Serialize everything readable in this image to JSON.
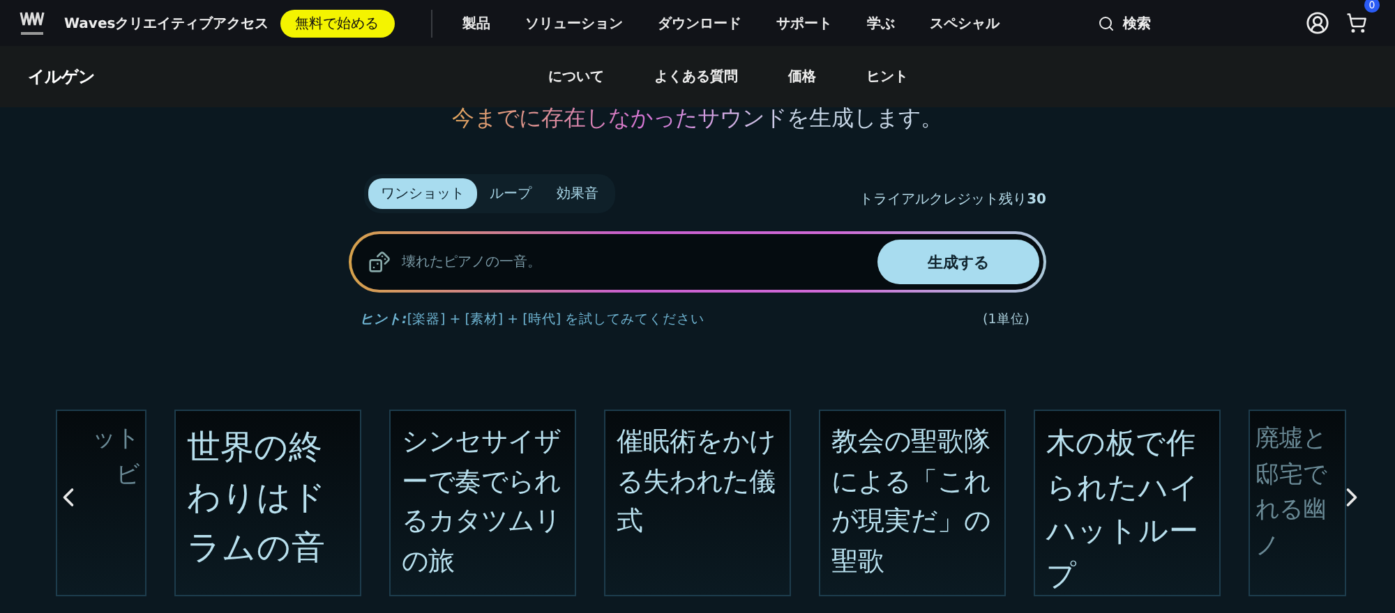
{
  "top_bar": {
    "brand": "Wavesクリエイティブアクセス",
    "cta": "無料で始める",
    "menu": [
      {
        "label": "製品"
      },
      {
        "label": "ソリューション"
      },
      {
        "label": "ダウンロード"
      },
      {
        "label": "サポート"
      },
      {
        "label": "学ぶ"
      },
      {
        "label": "スペシャル"
      }
    ],
    "search": "検索",
    "cart_count": "0"
  },
  "sub_bar": {
    "title": "イルゲン",
    "links": [
      {
        "label": "について"
      },
      {
        "label": "よくある質問"
      },
      {
        "label": "価格"
      },
      {
        "label": "ヒント"
      }
    ]
  },
  "headline": "今までに存在しなかったサウンドを生成します。",
  "mode_tabs": [
    {
      "label": "ワンショット",
      "selected": true
    },
    {
      "label": "ループ",
      "selected": false
    },
    {
      "label": "効果音",
      "selected": false
    }
  ],
  "credits": {
    "label": "トライアルクレジット残り",
    "count": "30"
  },
  "prompt": {
    "placeholder": "壊れたピアノの一音。",
    "button": "生成する"
  },
  "hint": "**ヒント:**[楽器] + [素材] + [時代] を試してみてください",
  "unit": "(1単位)",
  "cards": [
    {
      "kind": "partial_left",
      "text": "ットビ"
    },
    {
      "kind": "full",
      "text": "世界の終わりはドラムの音"
    },
    {
      "kind": "full",
      "text": "シンセサイザーで奏でられるカタツムリの旅"
    },
    {
      "kind": "full",
      "text": "催眠術をかける失われた儀式"
    },
    {
      "kind": "full",
      "text": "教会の聖歌隊による「これが現実だ」の聖歌"
    },
    {
      "kind": "full",
      "text": "木の板で作られたハイハットループ"
    },
    {
      "kind": "partial_right",
      "text": "廃墟と邸宅でれる幽ノ"
    }
  ]
}
